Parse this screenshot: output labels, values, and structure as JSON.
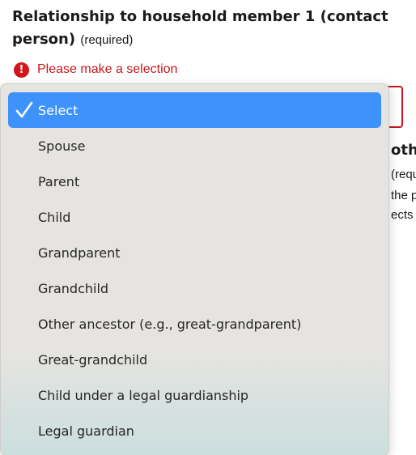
{
  "question": {
    "title": "Relationship to household member 1 (contact person)",
    "required_label": "(required)"
  },
  "error": {
    "icon": "exclamation-icon",
    "message": "Please make a selection",
    "color": "#c8171c"
  },
  "background_text": {
    "heading_fragment": "oth",
    "line1": "(requ",
    "line2": "the p",
    "line3": "ects t"
  },
  "dropdown": {
    "selected_value": "Select",
    "accent_color": "#3d93fb",
    "options": [
      "Select",
      "Spouse",
      "Parent",
      "Child",
      "Grandparent",
      "Grandchild",
      "Other ancestor (e.g., great-grandparent)",
      "Great-grandchild",
      "Child under a legal guardianship",
      "Legal guardian"
    ]
  }
}
